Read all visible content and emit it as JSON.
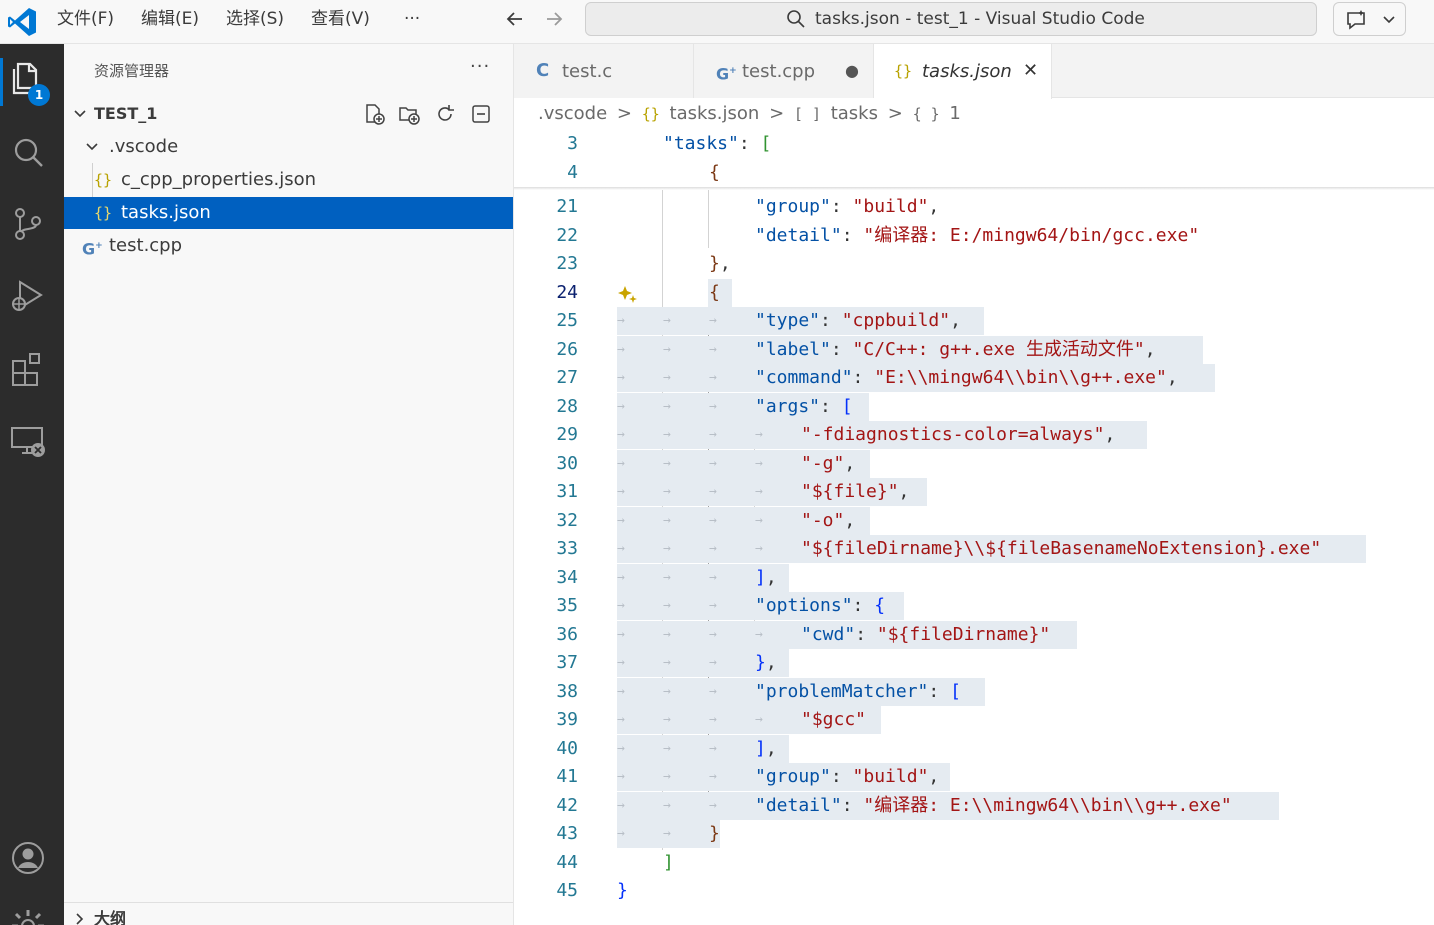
{
  "window": {
    "title": "tasks.json - test_1 - Visual Studio Code",
    "menus": [
      "文件(F)",
      "编辑(E)",
      "选择(S)",
      "查看(V)",
      "···"
    ]
  },
  "activity_bar": {
    "badge": "1",
    "icons": [
      "explorer-icon",
      "search-icon",
      "source-control-icon",
      "run-debug-icon",
      "extensions-icon",
      "remote-explorer-icon",
      "account-icon",
      "settings-icon"
    ]
  },
  "sidebar": {
    "title": "资源管理器",
    "more": "···",
    "workspace": "TEST_1",
    "folder": ".vscode",
    "files": [
      "c_cpp_properties.json",
      "tasks.json",
      "test.cpp"
    ],
    "outline": "大纲"
  },
  "tabs": [
    {
      "icon": "C",
      "label": "test.c"
    },
    {
      "icon": "C+",
      "label": "test.cpp",
      "dirty": "●"
    },
    {
      "icon": "{}",
      "label": "tasks.json",
      "close": "✕"
    }
  ],
  "breadcrumb": [
    ".vscode",
    ">",
    "{}",
    "tasks.json",
    ">",
    "[ ]",
    "tasks",
    ">",
    "{ }",
    "1"
  ],
  "editor": {
    "line_numbers": [
      "3",
      "4",
      "21",
      "22",
      "23",
      "24",
      "25",
      "26",
      "27",
      "28",
      "29",
      "30",
      "31",
      "32",
      "33",
      "34",
      "35",
      "36",
      "37",
      "38",
      "39",
      "40",
      "41",
      "42",
      "43",
      "44",
      "45"
    ],
    "lines": {
      "l3": {
        "key": "\"tasks\"",
        "tail": ": ",
        "br": "["
      },
      "l4": {
        "br": "{"
      },
      "l21": {
        "key": "\"group\"",
        "tail": ": ",
        "val": "\"build\"",
        "end": ","
      },
      "l22": {
        "key": "\"detail\"",
        "tail": ": ",
        "val": "\"编译器: E:/mingw64/bin/gcc.exe\""
      },
      "l23": {
        "br": "}",
        "end": ","
      },
      "l24": {
        "br": "{"
      },
      "l25": {
        "key": "\"type\"",
        "tail": ": ",
        "val": "\"cppbuild\"",
        "end": ","
      },
      "l26": {
        "key": "\"label\"",
        "tail": ": ",
        "val": "\"C/C++: g++.exe 生成活动文件\"",
        "end": ","
      },
      "l27": {
        "key": "\"command\"",
        "tail": ": ",
        "val": "\"E:\\\\mingw64\\\\bin\\\\g++.exe\"",
        "end": ","
      },
      "l28": {
        "key": "\"args\"",
        "tail": ": ",
        "br": "["
      },
      "l29": {
        "val": "\"-fdiagnostics-color=always\"",
        "end": ","
      },
      "l30": {
        "val": "\"-g\"",
        "end": ","
      },
      "l31": {
        "val": "\"${file}\"",
        "end": ","
      },
      "l32": {
        "val": "\"-o\"",
        "end": ","
      },
      "l33": {
        "val": "\"${fileDirname}\\\\${fileBasenameNoExtension}.exe\""
      },
      "l34": {
        "br": "]",
        "end": ","
      },
      "l35": {
        "key": "\"options\"",
        "tail": ": ",
        "br": "{"
      },
      "l36": {
        "key": "\"cwd\"",
        "tail": ": ",
        "val": "\"${fileDirname}\""
      },
      "l37": {
        "br": "}",
        "end": ","
      },
      "l38": {
        "key": "\"problemMatcher\"",
        "tail": ": ",
        "br": "["
      },
      "l39": {
        "val": "\"$gcc\""
      },
      "l40": {
        "br": "]",
        "end": ","
      },
      "l41": {
        "key": "\"group\"",
        "tail": ": ",
        "val": "\"build\"",
        "end": ","
      },
      "l42": {
        "key": "\"detail\"",
        "tail": ": ",
        "val": "\"编译器: E:\\\\mingw64\\\\bin\\\\g++.exe\""
      },
      "l43": {
        "br": "}"
      },
      "l44": {
        "br": "]"
      },
      "l45": {
        "br": "}"
      }
    }
  },
  "colors": {
    "accent": "#0078d4",
    "selection": "#0060c0",
    "json_key": "#0451a5",
    "json_string": "#a31515",
    "line_number": "#237893",
    "activity_bar": "#2c2c2c"
  }
}
